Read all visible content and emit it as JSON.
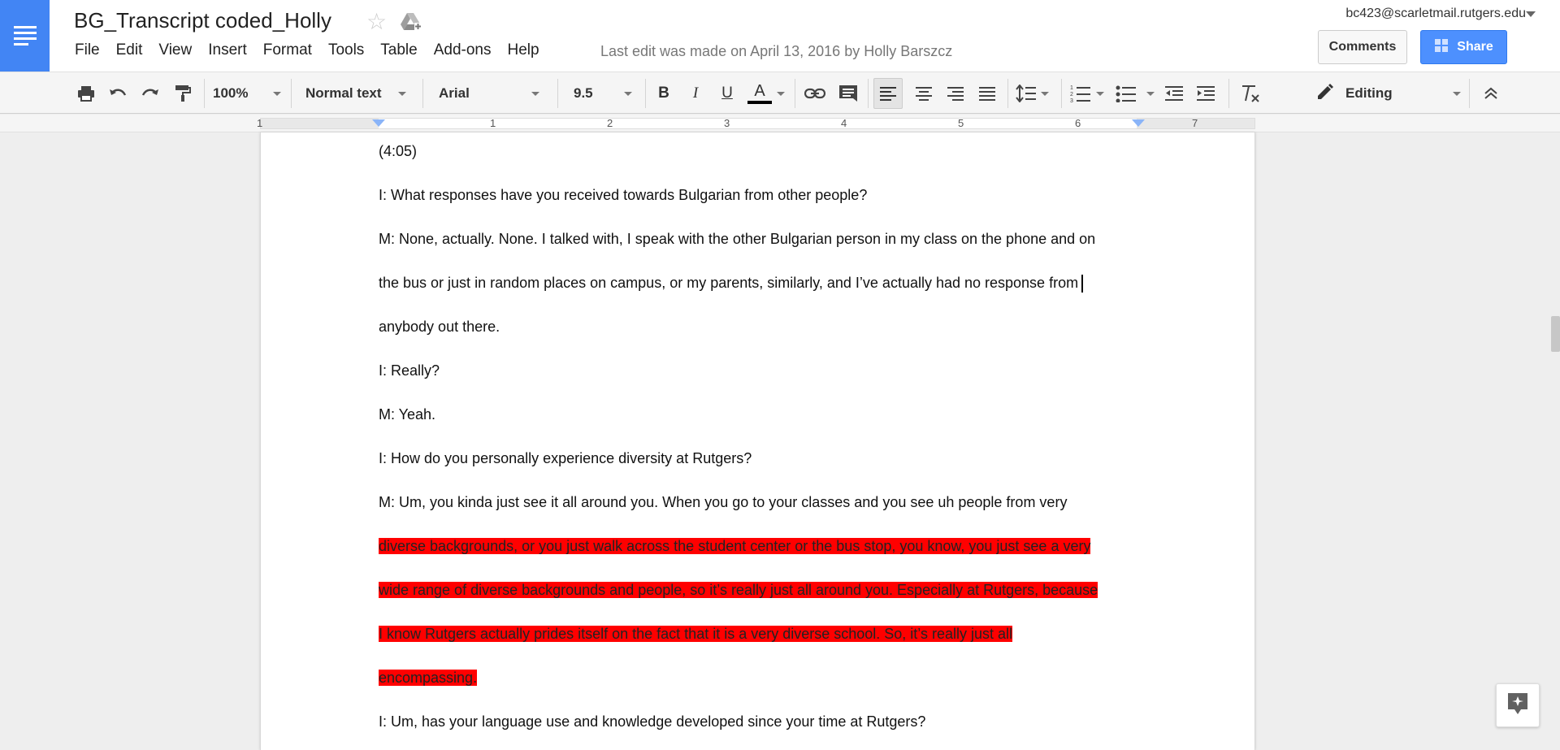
{
  "app": {
    "title": "BG_Transcript coded_Holly",
    "account": "bc423@scarletmail.rutgers.edu",
    "last_edit": "Last edit was made on April 13, 2016 by Holly Barszcz",
    "comments_label": "Comments",
    "share_label": "Share"
  },
  "menu": [
    "File",
    "Edit",
    "View",
    "Insert",
    "Format",
    "Tools",
    "Table",
    "Add-ons",
    "Help"
  ],
  "toolbar": {
    "zoom": "100%",
    "style": "Normal text",
    "font": "Arial",
    "size": "9.5",
    "bold": "B",
    "italic": "I",
    "underline": "U",
    "text_color": "A",
    "mode": "Editing"
  },
  "ruler": {
    "labels": [
      "1",
      "1",
      "2",
      "3",
      "4",
      "5",
      "6",
      "7"
    ]
  },
  "document": {
    "highlight_color": "#ff0000",
    "lines": [
      {
        "text": "(4:05)",
        "highlight": false
      },
      {
        "text": "I: What responses have you received towards Bulgarian from other people?",
        "highlight": false
      },
      {
        "text": "M: None, actually. None. I talked with, I speak with the other Bulgarian person in my class on the phone and on",
        "highlight": false
      },
      {
        "text": "the bus or just in random places on campus, or my parents, similarly, and I’ve actually had no response from",
        "highlight": false,
        "cursor": true
      },
      {
        "text": "anybody out there.",
        "highlight": false
      },
      {
        "text": "I: Really?",
        "highlight": false
      },
      {
        "text": "M: Yeah.",
        "highlight": false
      },
      {
        "text": "I: How do you personally experience diversity at Rutgers?",
        "highlight": false
      },
      {
        "text": "M: Um, you kinda just see it all around you. When you go to your classes and you see uh people from very",
        "highlight": false
      },
      {
        "text": "diverse backgrounds, or you just walk across the student center or the bus stop, you know, you just see a very",
        "highlight": true
      },
      {
        "text": "wide range of diverse backgrounds and people, so it’s really just all around you. Especially at Rutgers, because",
        "highlight": true
      },
      {
        "text": "I know Rutgers actually prides itself on the fact that it is a very diverse school. So, it’s really just all",
        "highlight": true
      },
      {
        "text": "encompassing.",
        "highlight": true
      },
      {
        "text": "I: Um, has your language use and knowledge developed since your time at Rutgers?",
        "highlight": false
      }
    ]
  }
}
